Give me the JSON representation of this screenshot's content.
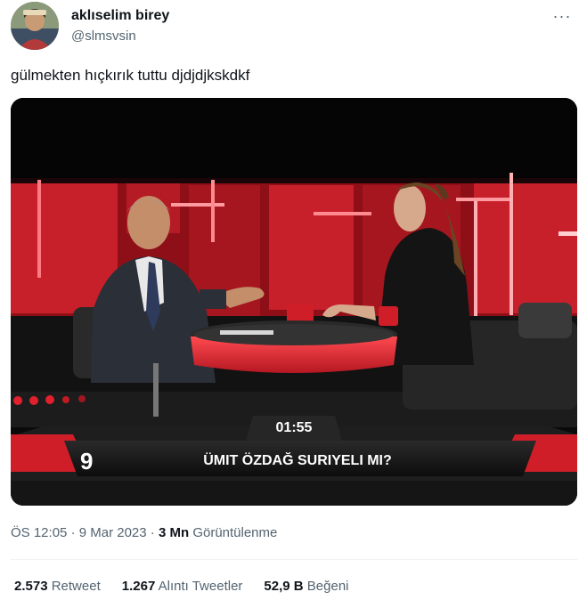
{
  "author": {
    "name": "aklıselim birey",
    "handle": "@slmsvsin",
    "avatar_icon": "profile-photo"
  },
  "more_icon": "more-horizontal-icon",
  "more_glyph": "···",
  "tweet": {
    "text": "gülmekten hıçkırık tuttu djdjdjkskdkf"
  },
  "video": {
    "timer": "01:55",
    "channel_number": "9",
    "caption": "ÜMIT ÖZDAĞ SURIYELI MI?"
  },
  "meta": {
    "time": "ÖS 12:05",
    "separator": "·",
    "date": "9 Mar 2023",
    "views_count": "3 Mn",
    "views_label": "Görüntülenme"
  },
  "stats": {
    "retweets_count": "2.573",
    "retweets_label": "Retweet",
    "quotes_count": "1.267",
    "quotes_label": "Alıntı Tweetler",
    "likes_count": "52,9 B",
    "likes_label": "Beğeni"
  },
  "colors": {
    "text_primary": "#0f1419",
    "text_secondary": "#536471",
    "studio_red": "#c8202a"
  }
}
